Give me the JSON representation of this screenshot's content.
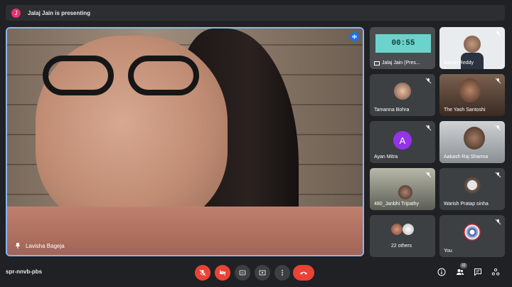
{
  "banner": {
    "avatar_letter": "J",
    "text": "Jalaj Jain is presenting"
  },
  "main": {
    "name": "Lavisha Bageja"
  },
  "presentation": {
    "timer": "00:55",
    "label": "Jalaj Jain (Pres..."
  },
  "participants": [
    {
      "name": "Savan Reddy"
    },
    {
      "name": "Tamanna Bohra"
    },
    {
      "name": "The Yash Santoshi"
    },
    {
      "name": "Ayan Mitra",
      "letter": "A"
    },
    {
      "name": "Aakash Raj Sharma"
    },
    {
      "name": "480_Janbhi Tripathy"
    },
    {
      "name": "Warish Pratap sinha"
    },
    {
      "name": "22 others"
    },
    {
      "name": "You"
    }
  ],
  "bottom": {
    "meeting_code": "spr-nnvb-pbs",
    "people_count": "32"
  },
  "colors": {
    "accent": "#1a73e8",
    "danger": "#ea4335",
    "tile": "#3c4043"
  }
}
